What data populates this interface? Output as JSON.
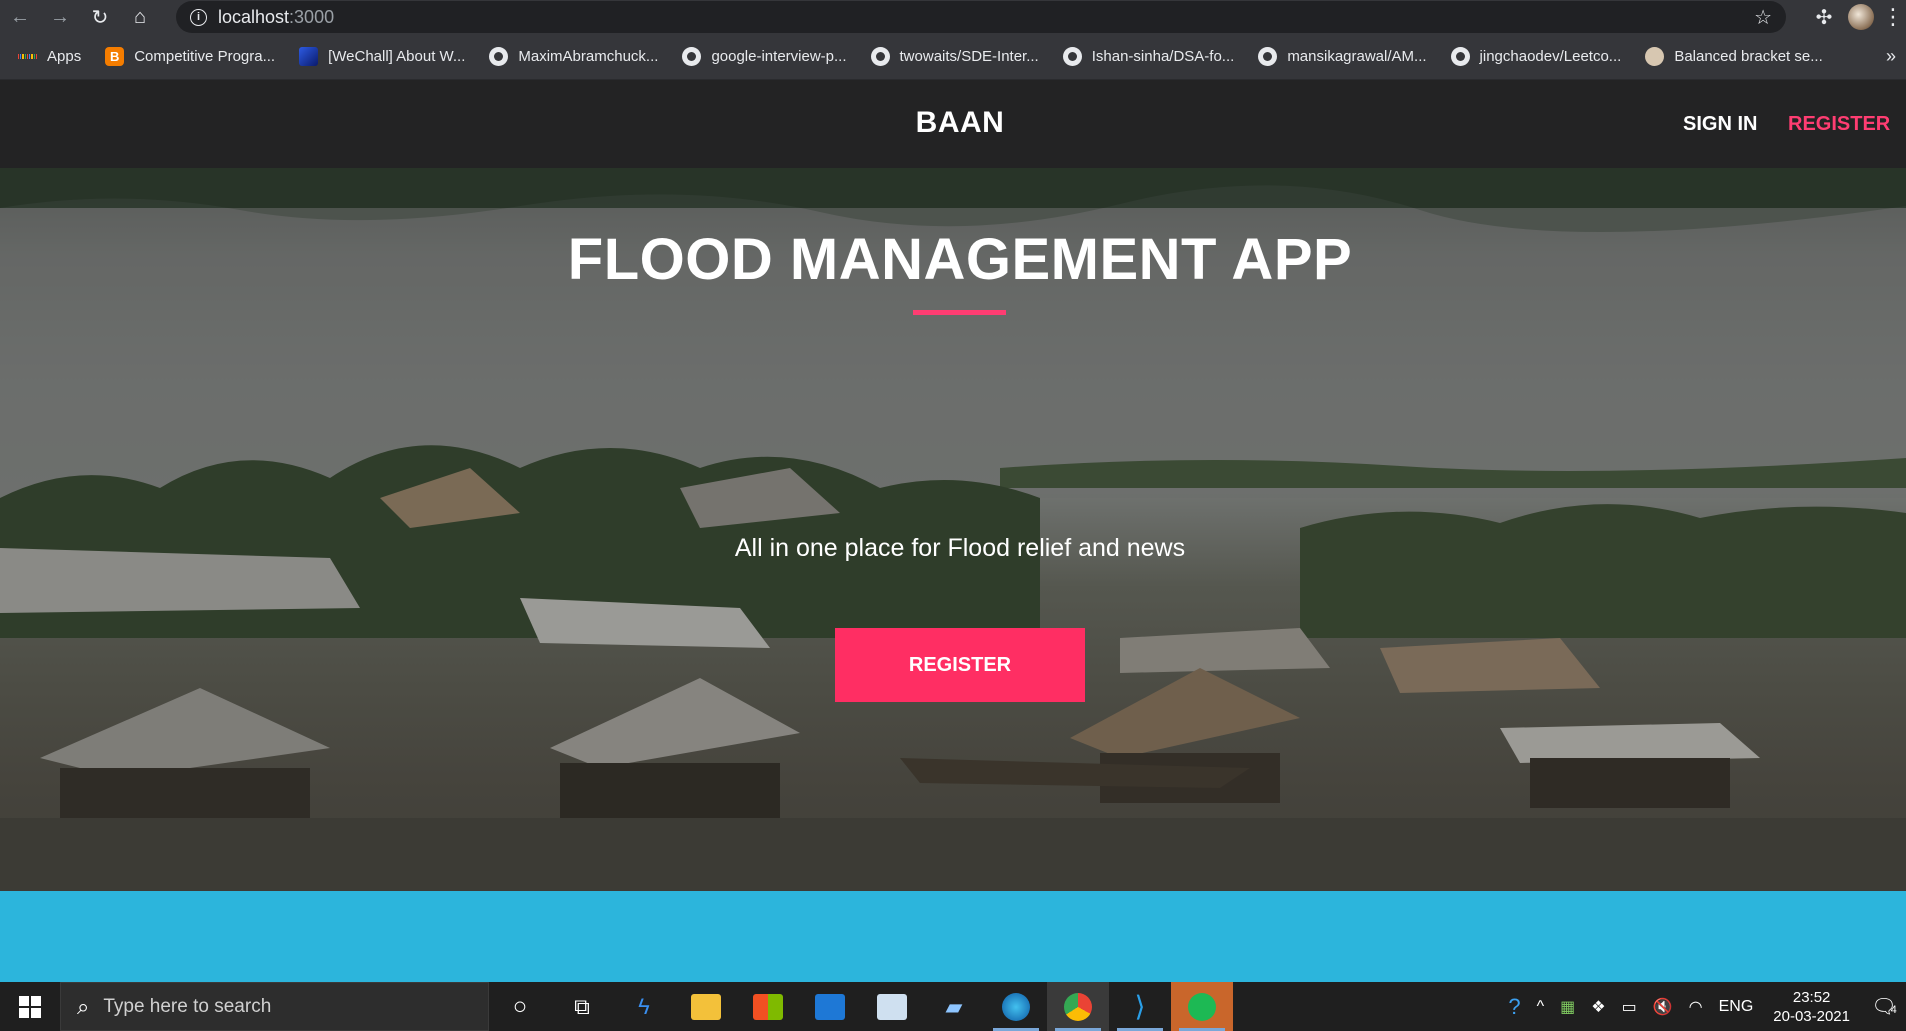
{
  "browser": {
    "url_host": "localhost",
    "url_port": ":3000",
    "bookmarks": [
      {
        "label": "Apps",
        "icon": "apps-grid-icon"
      },
      {
        "label": "Competitive Progra...",
        "icon": "blogger-icon"
      },
      {
        "label": "[WeChall] About W...",
        "icon": "wechall-icon"
      },
      {
        "label": "MaximAbramchuck...",
        "icon": "github-icon"
      },
      {
        "label": "google-interview-p...",
        "icon": "github-icon"
      },
      {
        "label": "twowaits/SDE-Inter...",
        "icon": "github-icon"
      },
      {
        "label": "Ishan-sinha/DSA-fo...",
        "icon": "github-icon"
      },
      {
        "label": "mansikagrawal/AM...",
        "icon": "github-icon"
      },
      {
        "label": "jingchaodev/Leetco...",
        "icon": "github-icon"
      },
      {
        "label": "Balanced bracket se...",
        "icon": "site-favicon-icon"
      }
    ],
    "more": "»"
  },
  "site": {
    "brand": "BAAN",
    "nav": {
      "signin": "SIGN IN",
      "register": "REGISTER"
    },
    "hero": {
      "title": "FLOOD MANAGEMENT APP",
      "subtitle": "All in one place for Flood relief and news",
      "cta": "REGISTER"
    },
    "colors": {
      "accent": "#ff2e63",
      "band": "#2cb5dc",
      "header": "#232324"
    }
  },
  "taskbar": {
    "search_placeholder": "Type here to search",
    "tray_lang": "ENG",
    "time": "23:52",
    "date": "20-03-2021",
    "notification_count": "4"
  }
}
